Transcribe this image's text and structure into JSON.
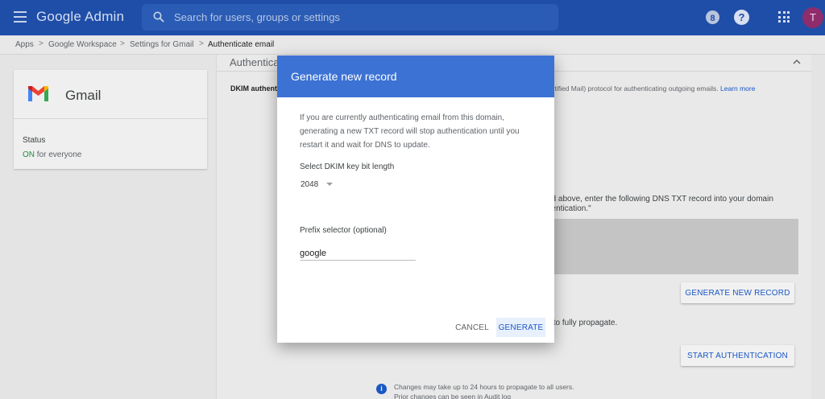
{
  "app": {
    "brand": "Google Admin"
  },
  "header": {
    "search_placeholder": "Search for users, groups or settings",
    "account_initial": "T",
    "notice_icon_glyph": "8",
    "help_glyph": "?"
  },
  "breadcrumb": {
    "items": [
      "Apps",
      "Google Workspace",
      "Settings for Gmail",
      "Authenticate email"
    ],
    "separator": ">"
  },
  "app_card": {
    "name": "Gmail",
    "status_label": "Status",
    "status_on": "ON",
    "status_suffix": " for everyone"
  },
  "main": {
    "section_title": "Authenticate email",
    "dkim_label": "DKIM authentication",
    "dkim_desc_visible": "entified Mail) protocol for authenticating outgoing emails.",
    "learn_more": "Learn more",
    "dns_text": "ed above, enter the following DNS TXT record into your domain hentication.\"",
    "generate_new_record": "GENERATE NEW RECORD",
    "propagate_text": "s to fully propagate.",
    "start_authentication": "START AUTHENTICATION",
    "info_glyph": "i",
    "note_line1": "Changes may take up to 24 hours to propagate to all users.",
    "note_line2": "Prior changes can be seen in Audit log"
  },
  "modal": {
    "title": "Generate new record",
    "warning": "If you are currently authenticating email from this domain, generating a new TXT record will stop authentication until you restart it and wait for DNS to update.",
    "key_length_label": "Select DKIM key bit length",
    "key_length_value": "2048",
    "prefix_label": "Prefix selector (optional)",
    "prefix_value": "google",
    "cancel": "CANCEL",
    "generate": "GENERATE"
  }
}
